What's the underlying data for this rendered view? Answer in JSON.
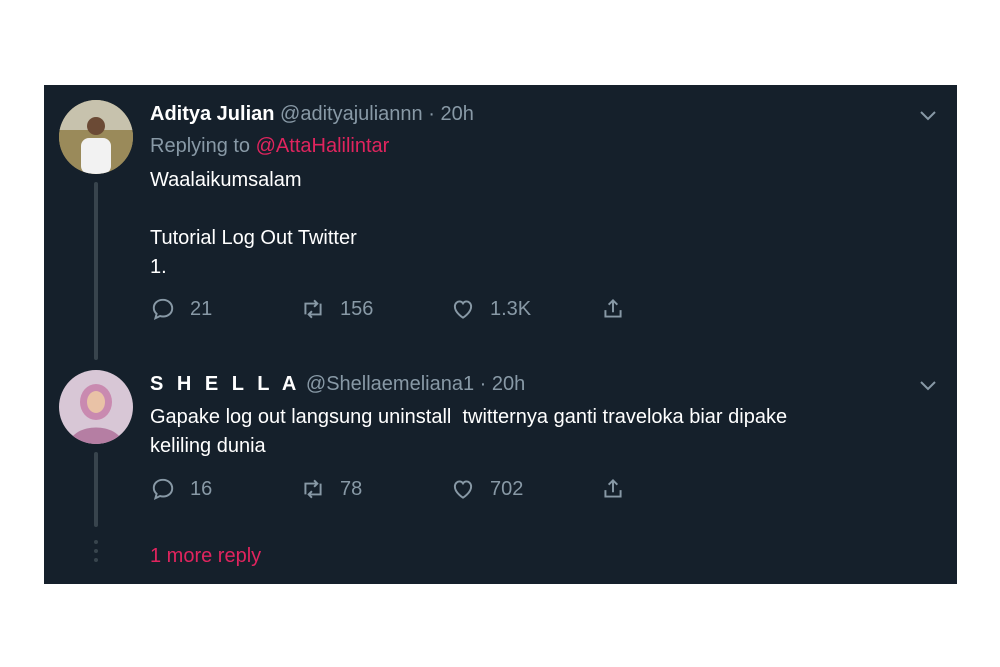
{
  "tweets": [
    {
      "name": "Aditya Julian",
      "handle": "@adityajuliannn",
      "sep": "·",
      "time": "20h",
      "replying_prefix": "Replying to ",
      "replying_to": "@AttaHalilintar",
      "text": "Waalaikumsalam\n\nTutorial Log Out Twitter\n1.",
      "replies": "21",
      "retweets": "156",
      "likes": "1.3K"
    },
    {
      "name": "S H E L L A",
      "handle": "@Shellaemeliana1",
      "sep": "·",
      "time": "20h",
      "text": "Gapake log out langsung uninstall  twitternya ganti traveloka biar dipake\nkeliling dunia",
      "replies": "16",
      "retweets": "78",
      "likes": "702"
    }
  ],
  "more_reply": "1 more reply",
  "colors": {
    "background": "#15202b",
    "text_secondary": "#8899a6",
    "accent": "#e0245e",
    "thread_line": "#38444d"
  },
  "icons": [
    "reply-icon",
    "retweet-icon",
    "like-icon",
    "share-icon",
    "chevron-down-icon"
  ]
}
